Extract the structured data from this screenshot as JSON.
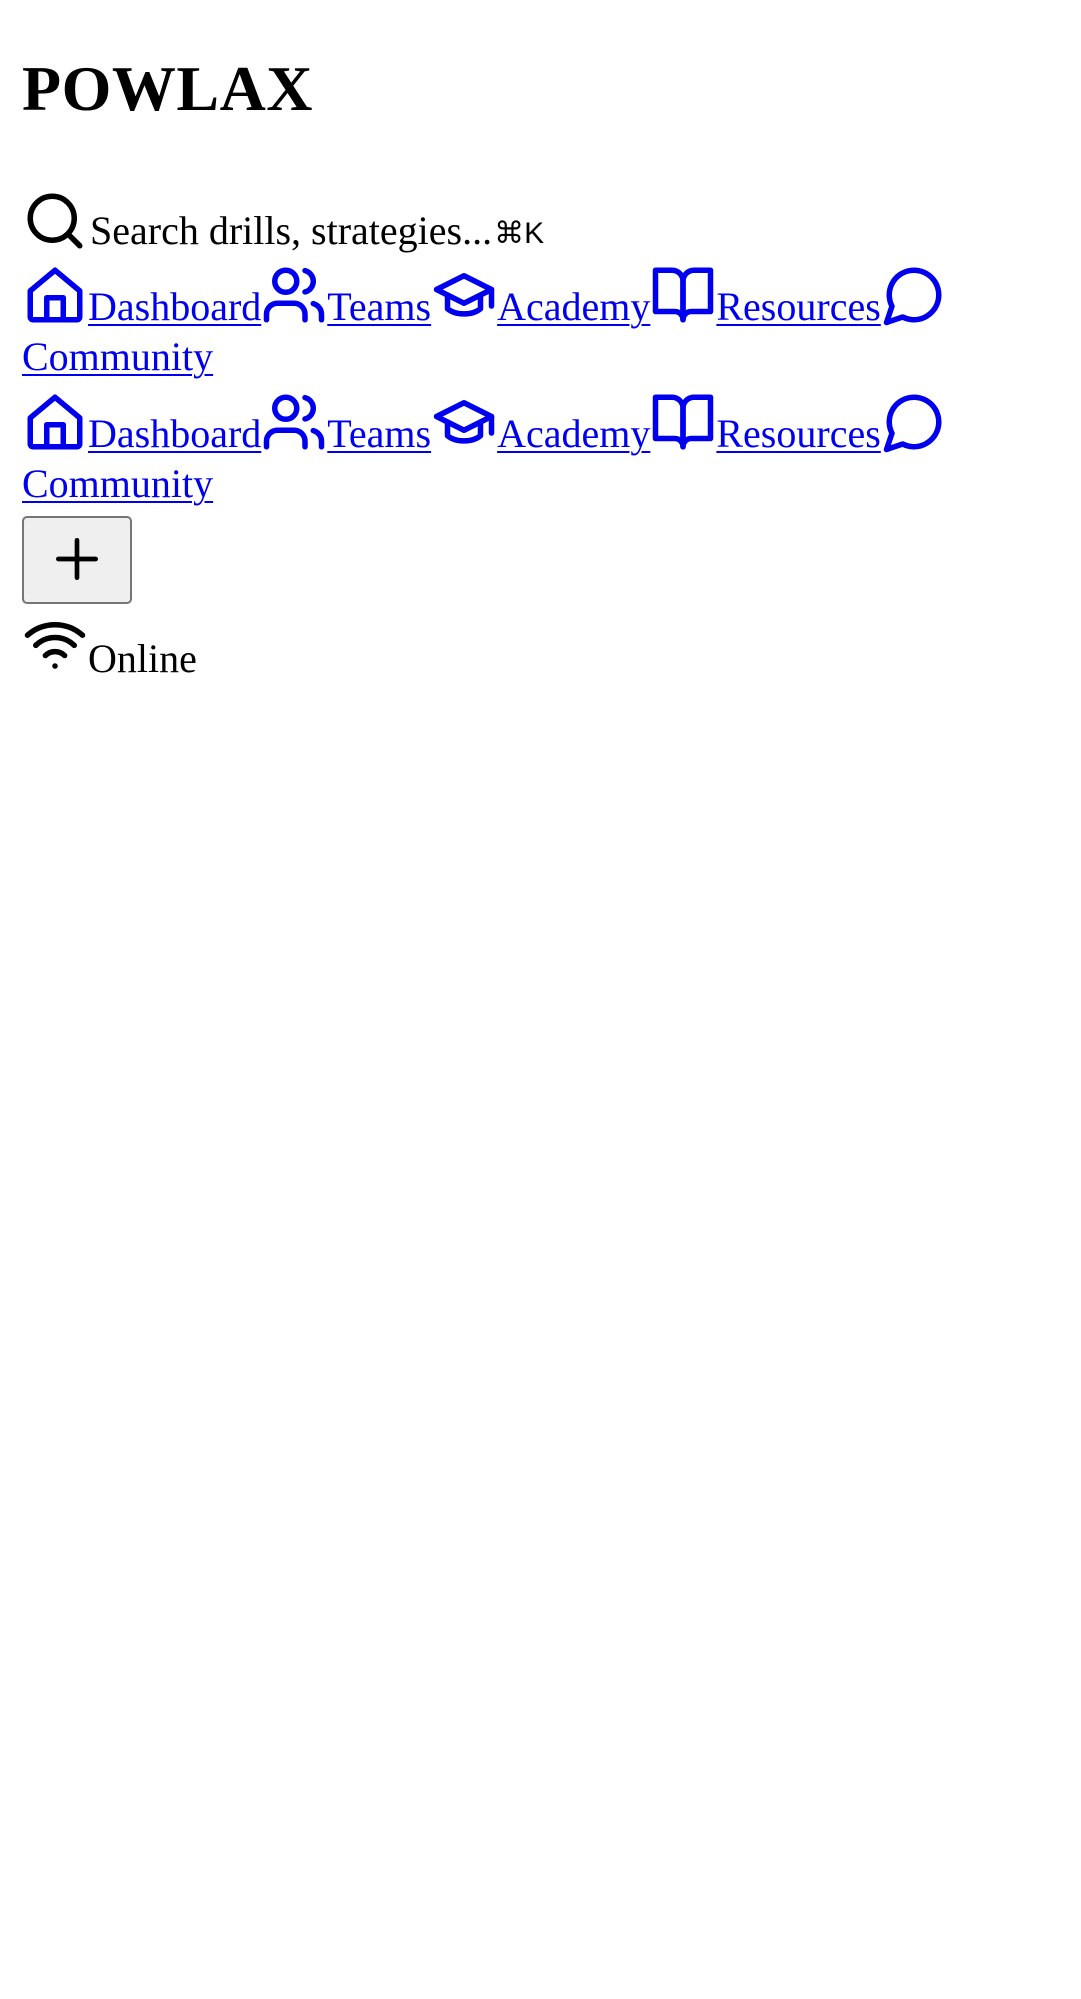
{
  "brand": {
    "name": "POWLAX"
  },
  "search": {
    "placeholder": "Search drills, strategies...",
    "shortcut": "⌘K",
    "icon": "search-icon"
  },
  "nav_primary": [
    {
      "label": "Dashboard",
      "icon": "home-icon"
    },
    {
      "label": "Teams",
      "icon": "users-icon"
    },
    {
      "label": "Academy",
      "icon": "graduation-cap-icon"
    },
    {
      "label": "Resources",
      "icon": "book-open-icon"
    },
    {
      "label": "Community",
      "icon": "message-circle-icon"
    }
  ],
  "nav_secondary": [
    {
      "label": "Dashboard",
      "icon": "home-icon"
    },
    {
      "label": "Teams",
      "icon": "users-icon"
    },
    {
      "label": "Academy",
      "icon": "graduation-cap-icon"
    },
    {
      "label": "Resources",
      "icon": "book-open-icon"
    },
    {
      "label": "Community",
      "icon": "message-circle-icon"
    }
  ],
  "actions": {
    "add_icon": "plus-icon"
  },
  "status": {
    "label": "Online",
    "icon": "wifi-icon"
  },
  "colors": {
    "link": "#0000ee",
    "text": "#000000",
    "button_bg": "#efefef",
    "button_border": "#767676"
  }
}
